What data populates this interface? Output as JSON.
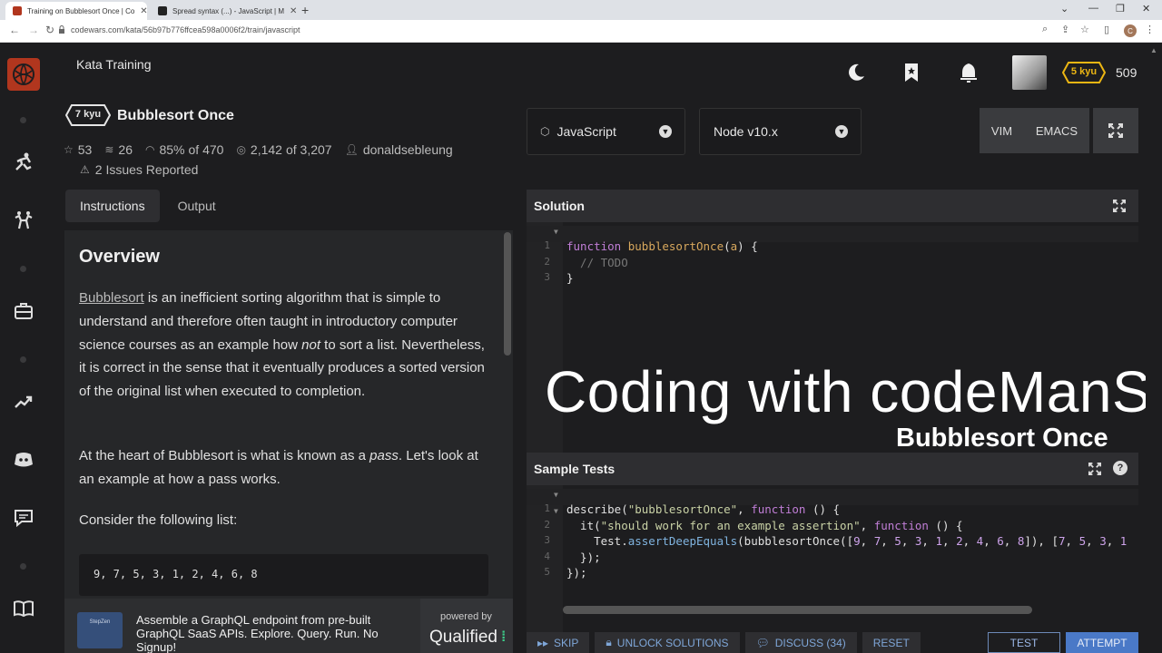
{
  "browser": {
    "tabs": [
      {
        "title": "Training on Bubblesort Once | Co"
      },
      {
        "title": "Spread syntax (...) - JavaScript | M"
      }
    ],
    "url": "codewars.com/kata/56b97b776ffcea598a0006f2/train/javascript",
    "profile_initial": "C"
  },
  "header": {
    "section_title": "Kata Training",
    "rank": "5 kyu",
    "honor": "509"
  },
  "kata": {
    "kyu": "7 kyu",
    "name": "Bubblesort Once",
    "stars": "53",
    "collections": "26",
    "satisfaction": "85%",
    "satisfaction_of": "of 470",
    "completed": "2,142",
    "completed_of": "of 3,207",
    "author": "donaldsebleung",
    "issues": "2 Issues Reported"
  },
  "panel_tabs": [
    "Instructions",
    "Output"
  ],
  "instructions": {
    "heading": "Overview",
    "p1_link": "Bubblesort",
    "p1_a": " is an inefficient sorting algorithm that is simple to understand and therefore often taught in introductory computer science courses as an example how ",
    "p1_em": "not",
    "p1_b": " to sort a list. Nevertheless, it is correct in the sense that it eventually produces a sorted version of the original list when executed to completion.",
    "p2_a": "At the heart of Bubblesort is what is known as a ",
    "p2_em": "pass",
    "p2_b": ". Let's look at an example at how a pass works.",
    "p3": "Consider the following list:",
    "code_list": "9, 7, 5, 3, 1, 2, 4, 6, 8"
  },
  "ad": {
    "logo_text": "StepZen",
    "text": "Assemble a GraphQL endpoint from pre-built GraphQL SaaS APIs. Explore. Query. Run. No Signup!",
    "powered_by": "powered by",
    "brand": "Qualified"
  },
  "editor_controls": {
    "language": "JavaScript",
    "runtime": "Node v10.x",
    "mode_vim": "VIM",
    "mode_emacs": "EMACS"
  },
  "solution": {
    "title": "Solution",
    "line_numbers": [
      "1",
      "2",
      "3"
    ]
  },
  "sample_tests": {
    "title": "Sample Tests",
    "line_numbers": [
      "1",
      "2",
      "3",
      "4",
      "5"
    ]
  },
  "overlay": {
    "title": "Coding with codeManS",
    "subtitle": "Bubblesort Once"
  },
  "actions": {
    "skip": "SKIP",
    "unlock": "UNLOCK SOLUTIONS",
    "discuss": "DISCUSS (34)",
    "reset": "RESET",
    "test": "TEST",
    "attempt": "ATTEMPT"
  },
  "colors": {
    "brand": "#b1361e",
    "rank_yellow": "#ecb613",
    "attempt_blue": "#4a79c7"
  }
}
